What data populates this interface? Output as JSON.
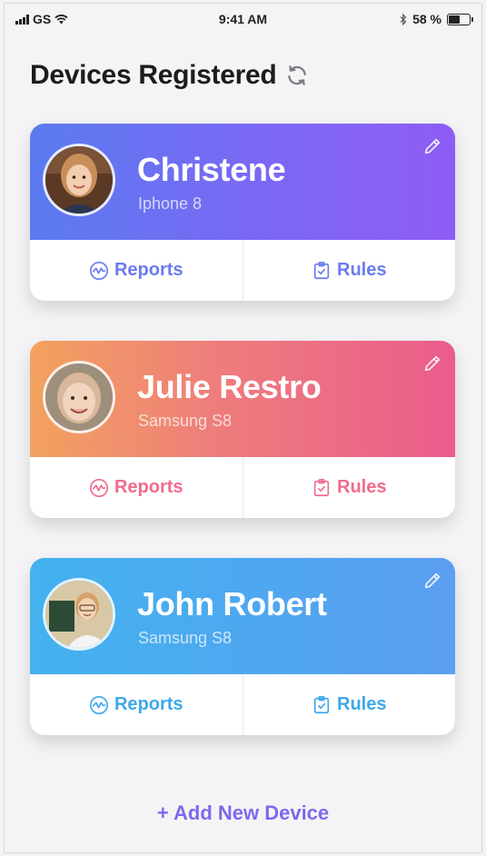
{
  "status_bar": {
    "carrier": "GS",
    "time": "9:41 AM",
    "battery": "58 %",
    "battery_level": 0.58,
    "icons": [
      "signal-icon",
      "wifi-icon",
      "bluetooth-icon",
      "battery-icon"
    ]
  },
  "header": {
    "title": "Devices Registered",
    "refresh_icon": "refresh-icon"
  },
  "devices": [
    {
      "name": "Christene",
      "device": "Iphone 8",
      "reports_label": "Reports",
      "rules_label": "Rules",
      "accent": "#6b7bf0"
    },
    {
      "name": "Julie Restro",
      "device": "Samsung S8",
      "reports_label": "Reports",
      "rules_label": "Rules",
      "accent": "#ef6c8c"
    },
    {
      "name": "John Robert",
      "device": "Samsung S8",
      "reports_label": "Reports",
      "rules_label": "Rules",
      "accent": "#3fa7ea"
    }
  ],
  "add_device_label": "+ Add New Device",
  "colors": {
    "card1_gradient": [
      "#5b7bf0",
      "#8e5cf4"
    ],
    "card2_gradient": [
      "#f2a25e",
      "#ea5c8c"
    ],
    "card3_gradient": [
      "#43b2ee",
      "#5c9ef2"
    ],
    "add_link": "#7f68ec"
  }
}
